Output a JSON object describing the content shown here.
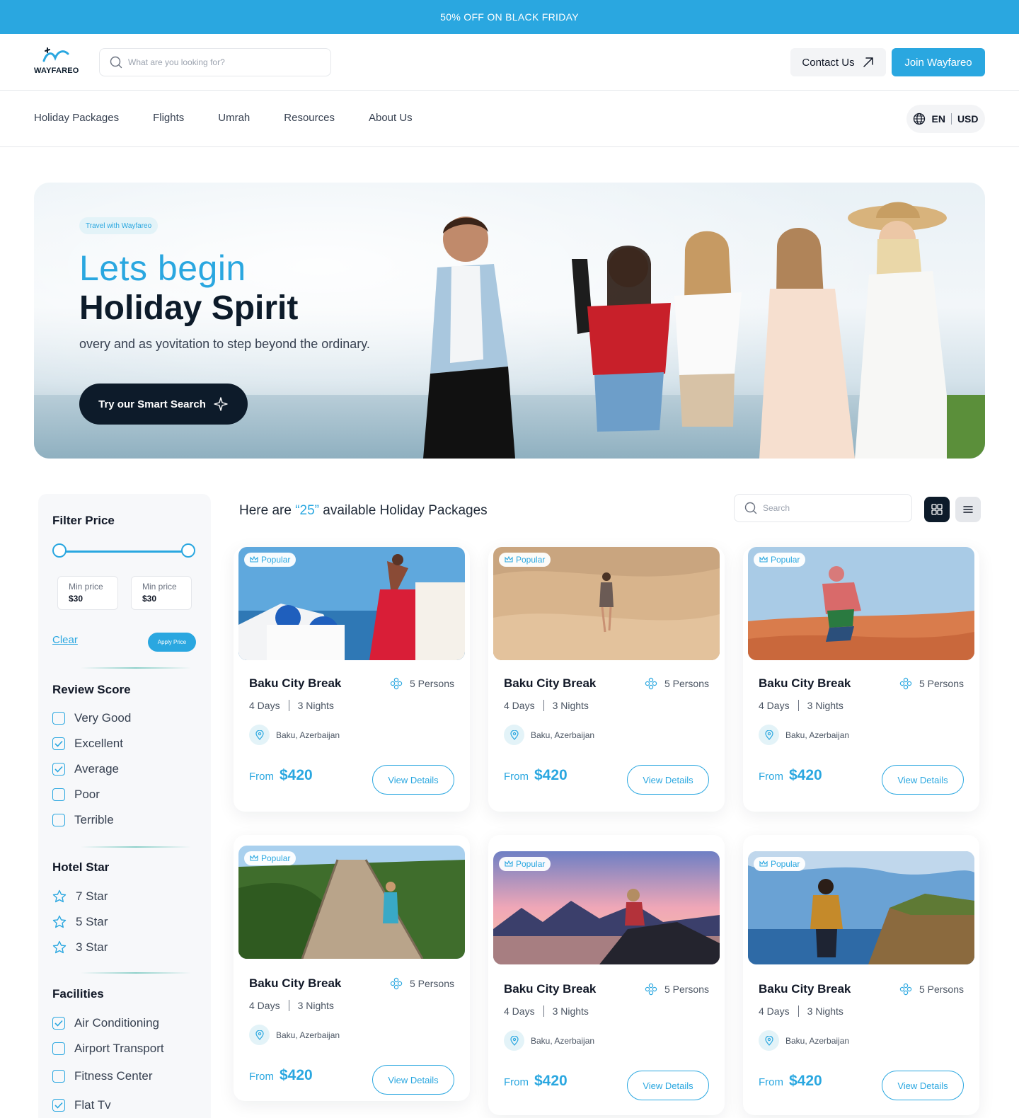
{
  "promo": {
    "text": "50% OFF ON BLACK FRIDAY"
  },
  "header": {
    "logo_text": "WAYFAREO",
    "search_placeholder": "What are you looking for?",
    "contact_label": "Contact Us",
    "join_label": "Join Wayfareo"
  },
  "nav": {
    "items": [
      "Holiday Packages",
      "Flights",
      "Umrah",
      "Resources",
      "About Us"
    ],
    "language": "EN",
    "currency": "USD"
  },
  "hero": {
    "pill": "Travel with Wayfareo",
    "headline_line1": "Lets begin",
    "headline_line2": "Holiday Spirit",
    "subtitle": "overy and  as yovitation to step beyond the ordinary.",
    "cta_label": "Try our Smart Search"
  },
  "filters": {
    "price_title": "Filter Price",
    "min_label": "Min price",
    "min_value": "$30",
    "max_label": "Min price",
    "max_value": "$30",
    "clear_label": "Clear",
    "apply_label": "Apply Price",
    "review_title": "Review Score",
    "review_options": [
      {
        "label": "Very Good",
        "checked": false
      },
      {
        "label": "Excellent",
        "checked": true
      },
      {
        "label": "Average",
        "checked": true
      },
      {
        "label": "Poor",
        "checked": false
      },
      {
        "label": "Terrible",
        "checked": false
      }
    ],
    "hotel_title": "Hotel Star",
    "hotel_options": [
      "7 Star",
      "5 Star",
      "3 Star"
    ],
    "facilities_title": "Facilities",
    "facilities": [
      {
        "label": "Air Conditioning",
        "checked": true
      },
      {
        "label": "Airport Transport",
        "checked": false
      },
      {
        "label": "Fitness Center",
        "checked": false
      },
      {
        "label": "Flat Tv",
        "checked": true
      }
    ]
  },
  "listing": {
    "heading_prefix": "Here are ",
    "count": "“25”",
    "heading_suffix": " available Holiday Packages",
    "search_placeholder": "Search",
    "packages": [
      {
        "badge": "Popular",
        "title": "Baku City Break",
        "persons": "5 Persons",
        "days": "4 Days",
        "nights": "3 Nights",
        "location": "Baku, Azerbaijan",
        "from": "From",
        "price": "$420",
        "button": "View Details"
      },
      {
        "badge": "Popular",
        "title": "Baku City Break",
        "persons": "5 Persons",
        "days": "4 Days",
        "nights": "3 Nights",
        "location": "Baku, Azerbaijan",
        "from": "From",
        "price": "$420",
        "button": "View Details"
      },
      {
        "badge": "Popular",
        "title": "Baku City Break",
        "persons": "5 Persons",
        "days": "4 Days",
        "nights": "3 Nights",
        "location": "Baku, Azerbaijan",
        "from": "From",
        "price": "$420",
        "button": "View Details"
      },
      {
        "badge": "Popular",
        "title": "Baku City Break",
        "persons": "5 Persons",
        "days": "4 Days",
        "nights": "3 Nights",
        "location": "Baku, Azerbaijan",
        "from": "From",
        "price": "$420",
        "button": "View Details"
      },
      {
        "badge": "Popular",
        "title": "Baku City Break",
        "persons": "5 Persons",
        "days": "4 Days",
        "nights": "3 Nights",
        "location": "Baku, Azerbaijan",
        "from": "From",
        "price": "$420",
        "button": "View Details"
      },
      {
        "badge": "Popular",
        "title": "Baku City Break",
        "persons": "5 Persons",
        "days": "4 Days",
        "nights": "3 Nights",
        "location": "Baku, Azerbaijan",
        "from": "From",
        "price": "$420",
        "button": "View Details"
      }
    ]
  },
  "colors": {
    "accent": "#2aa7e0",
    "dark": "#0d1b2a",
    "muted_bg": "#f3f4f6"
  },
  "icons": [
    "search-icon",
    "arrow-up-right-icon",
    "globe-icon",
    "sparkle-icon",
    "checkbox-icon",
    "star-icon",
    "grid-view-icon",
    "list-view-icon",
    "crown-icon",
    "persons-icon",
    "map-pin-icon"
  ]
}
